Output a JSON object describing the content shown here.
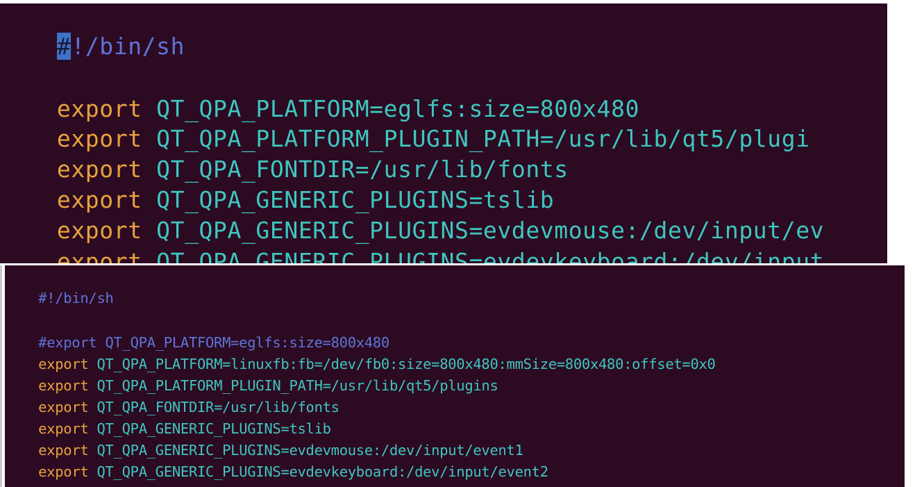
{
  "top": {
    "shebang_cursor_char": "#",
    "shebang_rest": "!/bin/sh",
    "lines": [
      {
        "kw": "export",
        "code": " QT_QPA_PLATFORM=eglfs:size=800x480"
      },
      {
        "kw": "export",
        "code": " QT_QPA_PLATFORM_PLUGIN_PATH=/usr/lib/qt5/plugi"
      },
      {
        "kw": "export",
        "code": " QT_QPA_FONTDIR=/usr/lib/fonts"
      },
      {
        "kw": "export",
        "code": " QT_QPA_GENERIC_PLUGINS=tslib"
      },
      {
        "kw": "export",
        "code": " QT_QPA_GENERIC_PLUGINS=evdevmouse:/dev/input/ev"
      },
      {
        "kw": "export",
        "code": " QT_QPA_GENERIC_PLUGINS=evdevkeyboard:/dev/input"
      }
    ]
  },
  "bottom": {
    "shebang": "#!/bin/sh",
    "commented_line": "#export QT_QPA_PLATFORM=eglfs:size=800x480",
    "lines": [
      {
        "kw": "export",
        "code": " QT_QPA_PLATFORM=linuxfb:fb=/dev/fb0:size=800x480:mmSize=800x480:offset=0x0"
      },
      {
        "kw": "export",
        "code": " QT_QPA_PLATFORM_PLUGIN_PATH=/usr/lib/qt5/plugins"
      },
      {
        "kw": "export",
        "code": " QT_QPA_FONTDIR=/usr/lib/fonts"
      },
      {
        "kw": "export",
        "code": " QT_QPA_GENERIC_PLUGINS=tslib"
      },
      {
        "kw": "export",
        "code": " QT_QPA_GENERIC_PLUGINS=evdevmouse:/dev/input/event1"
      },
      {
        "kw": "export",
        "code": " QT_QPA_GENERIC_PLUGINS=evdevkeyboard:/dev/input/event2"
      }
    ]
  },
  "colors": {
    "background": "#2c0a22",
    "keyword": "#e8a33a",
    "code": "#3fc6c0",
    "comment": "#5f74d8",
    "cursor": "#3e72c9"
  }
}
